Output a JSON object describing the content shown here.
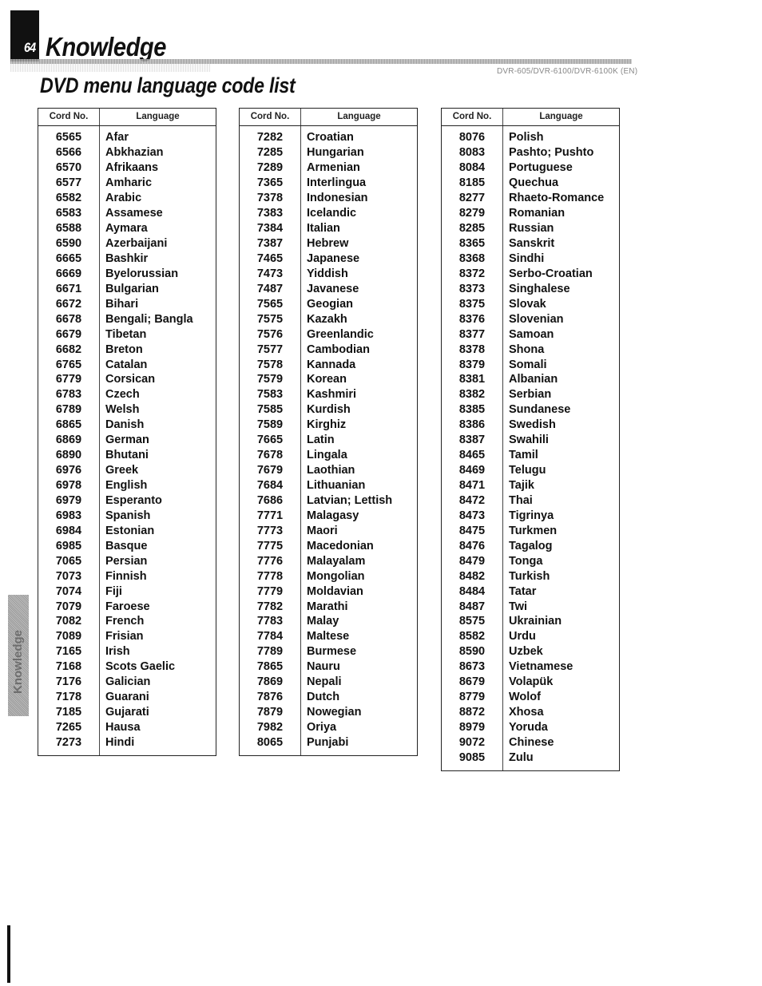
{
  "header": {
    "page_number": "64",
    "section_title": "Knowledge",
    "model_label": "DVR-605/DVR-6100/DVR-6100K (EN)",
    "page_heading": "DVD menu language code list"
  },
  "side_tab": {
    "label": "Knowledge"
  },
  "table_headers": {
    "code": "Cord No.",
    "language": "Language"
  },
  "tables": [
    {
      "rows": [
        {
          "code": "6565",
          "language": "Afar"
        },
        {
          "code": "6566",
          "language": "Abkhazian"
        },
        {
          "code": "6570",
          "language": "Afrikaans"
        },
        {
          "code": "6577",
          "language": "Amharic"
        },
        {
          "code": "6582",
          "language": "Arabic"
        },
        {
          "code": "6583",
          "language": "Assamese"
        },
        {
          "code": "6588",
          "language": "Aymara"
        },
        {
          "code": "6590",
          "language": "Azerbaijani"
        },
        {
          "code": "6665",
          "language": "Bashkir"
        },
        {
          "code": "6669",
          "language": "Byelorussian"
        },
        {
          "code": "6671",
          "language": "Bulgarian"
        },
        {
          "code": "6672",
          "language": "Bihari"
        },
        {
          "code": "6678",
          "language": "Bengali; Bangla"
        },
        {
          "code": "6679",
          "language": "Tibetan"
        },
        {
          "code": "6682",
          "language": "Breton"
        },
        {
          "code": "6765",
          "language": "Catalan"
        },
        {
          "code": "6779",
          "language": "Corsican"
        },
        {
          "code": "6783",
          "language": "Czech"
        },
        {
          "code": "6789",
          "language": "Welsh"
        },
        {
          "code": "6865",
          "language": "Danish"
        },
        {
          "code": "6869",
          "language": "German"
        },
        {
          "code": "6890",
          "language": "Bhutani"
        },
        {
          "code": "6976",
          "language": "Greek"
        },
        {
          "code": "6978",
          "language": "English"
        },
        {
          "code": "6979",
          "language": "Esperanto"
        },
        {
          "code": "6983",
          "language": "Spanish"
        },
        {
          "code": "6984",
          "language": "Estonian"
        },
        {
          "code": "6985",
          "language": "Basque"
        },
        {
          "code": "7065",
          "language": "Persian"
        },
        {
          "code": "7073",
          "language": "Finnish"
        },
        {
          "code": "7074",
          "language": "Fiji"
        },
        {
          "code": "7079",
          "language": "Faroese"
        },
        {
          "code": "7082",
          "language": "French"
        },
        {
          "code": "7089",
          "language": "Frisian"
        },
        {
          "code": "7165",
          "language": "Irish"
        },
        {
          "code": "7168",
          "language": "Scots Gaelic"
        },
        {
          "code": "7176",
          "language": "Galician"
        },
        {
          "code": "7178",
          "language": "Guarani"
        },
        {
          "code": "7185",
          "language": "Gujarati"
        },
        {
          "code": "7265",
          "language": "Hausa"
        },
        {
          "code": "7273",
          "language": "Hindi"
        }
      ]
    },
    {
      "rows": [
        {
          "code": "7282",
          "language": "Croatian"
        },
        {
          "code": "7285",
          "language": "Hungarian"
        },
        {
          "code": "7289",
          "language": "Armenian"
        },
        {
          "code": "7365",
          "language": "Interlingua"
        },
        {
          "code": "7378",
          "language": "Indonesian"
        },
        {
          "code": "7383",
          "language": "Icelandic"
        },
        {
          "code": "7384",
          "language": "Italian"
        },
        {
          "code": "7387",
          "language": "Hebrew"
        },
        {
          "code": "7465",
          "language": "Japanese"
        },
        {
          "code": "7473",
          "language": "Yiddish"
        },
        {
          "code": "7487",
          "language": "Javanese"
        },
        {
          "code": "7565",
          "language": "Geogian"
        },
        {
          "code": "7575",
          "language": "Kazakh"
        },
        {
          "code": "7576",
          "language": "Greenlandic"
        },
        {
          "code": "7577",
          "language": "Cambodian"
        },
        {
          "code": "7578",
          "language": "Kannada"
        },
        {
          "code": "7579",
          "language": "Korean"
        },
        {
          "code": "7583",
          "language": "Kashmiri"
        },
        {
          "code": "7585",
          "language": "Kurdish"
        },
        {
          "code": "7589",
          "language": "Kirghiz"
        },
        {
          "code": "7665",
          "language": "Latin"
        },
        {
          "code": "7678",
          "language": "Lingala"
        },
        {
          "code": "7679",
          "language": "Laothian"
        },
        {
          "code": "7684",
          "language": "Lithuanian"
        },
        {
          "code": "7686",
          "language": "Latvian; Lettish"
        },
        {
          "code": "7771",
          "language": "Malagasy"
        },
        {
          "code": "7773",
          "language": "Maori"
        },
        {
          "code": "7775",
          "language": "Macedonian"
        },
        {
          "code": "7776",
          "language": "Malayalam"
        },
        {
          "code": "7778",
          "language": "Mongolian"
        },
        {
          "code": "7779",
          "language": "Moldavian"
        },
        {
          "code": "7782",
          "language": "Marathi"
        },
        {
          "code": "7783",
          "language": "Malay"
        },
        {
          "code": "7784",
          "language": "Maltese"
        },
        {
          "code": "7789",
          "language": "Burmese"
        },
        {
          "code": "7865",
          "language": "Nauru"
        },
        {
          "code": "7869",
          "language": "Nepali"
        },
        {
          "code": "7876",
          "language": "Dutch"
        },
        {
          "code": "7879",
          "language": "Nowegian"
        },
        {
          "code": "7982",
          "language": "Oriya"
        },
        {
          "code": "8065",
          "language": "Punjabi"
        }
      ]
    },
    {
      "rows": [
        {
          "code": "8076",
          "language": "Polish"
        },
        {
          "code": "8083",
          "language": "Pashto; Pushto"
        },
        {
          "code": "8084",
          "language": "Portuguese"
        },
        {
          "code": "8185",
          "language": "Quechua"
        },
        {
          "code": "8277",
          "language": "Rhaeto-Romance"
        },
        {
          "code": "8279",
          "language": "Romanian"
        },
        {
          "code": "8285",
          "language": "Russian"
        },
        {
          "code": "8365",
          "language": "Sanskrit"
        },
        {
          "code": "8368",
          "language": "Sindhi"
        },
        {
          "code": "8372",
          "language": "Serbo-Croatian"
        },
        {
          "code": "8373",
          "language": "Singhalese"
        },
        {
          "code": "8375",
          "language": "Slovak"
        },
        {
          "code": "8376",
          "language": "Slovenian"
        },
        {
          "code": "8377",
          "language": "Samoan"
        },
        {
          "code": "8378",
          "language": "Shona"
        },
        {
          "code": "8379",
          "language": "Somali"
        },
        {
          "code": "8381",
          "language": "Albanian"
        },
        {
          "code": "8382",
          "language": "Serbian"
        },
        {
          "code": "8385",
          "language": "Sundanese"
        },
        {
          "code": "8386",
          "language": "Swedish"
        },
        {
          "code": "8387",
          "language": "Swahili"
        },
        {
          "code": "8465",
          "language": "Tamil"
        },
        {
          "code": "8469",
          "language": "Telugu"
        },
        {
          "code": "8471",
          "language": "Tajik"
        },
        {
          "code": "8472",
          "language": "Thai"
        },
        {
          "code": "8473",
          "language": "Tigrinya"
        },
        {
          "code": "8475",
          "language": "Turkmen"
        },
        {
          "code": "8476",
          "language": "Tagalog"
        },
        {
          "code": "8479",
          "language": "Tonga"
        },
        {
          "code": "8482",
          "language": "Turkish"
        },
        {
          "code": "8484",
          "language": "Tatar"
        },
        {
          "code": "8487",
          "language": "Twi"
        },
        {
          "code": "8575",
          "language": "Ukrainian"
        },
        {
          "code": "8582",
          "language": "Urdu"
        },
        {
          "code": "8590",
          "language": "Uzbek"
        },
        {
          "code": "8673",
          "language": "Vietnamese"
        },
        {
          "code": "8679",
          "language": "Volapük"
        },
        {
          "code": "8779",
          "language": "Wolof"
        },
        {
          "code": "8872",
          "language": "Xhosa"
        },
        {
          "code": "8979",
          "language": "Yoruda"
        },
        {
          "code": "9072",
          "language": "Chinese"
        },
        {
          "code": "9085",
          "language": "Zulu"
        }
      ]
    }
  ]
}
